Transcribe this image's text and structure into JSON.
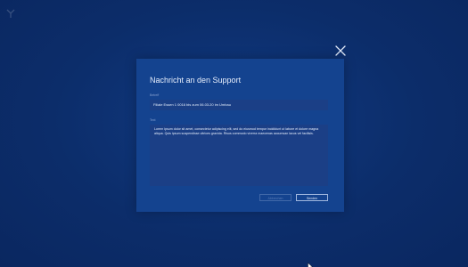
{
  "modal": {
    "title": "Nachricht an den Support",
    "subject": {
      "label": "Betreff",
      "value": "Filiale Essen 1 0016 bis zum 06.03.20 im Umbau"
    },
    "message": {
      "label": "Text",
      "value": "Lorem ipsum dolor sit amet, consectetur adipiscing elit, sed do eiusmod tempor incididunt ut labore et dolore magna aliqua. Quis ipsum suspendisse ultrices gravida. Risus commodo viverra maecenas accumsan lacus vel facilisis."
    },
    "buttons": {
      "cancel": "Abbrechen",
      "send": "Senden"
    }
  },
  "colors": {
    "background": "#0c2c66",
    "modal": "#14438f",
    "input": "#1b3f86",
    "text": "#e6eefc"
  },
  "icons": [
    "app-logo-icon",
    "close-icon",
    "mouse-cursor-icon"
  ]
}
